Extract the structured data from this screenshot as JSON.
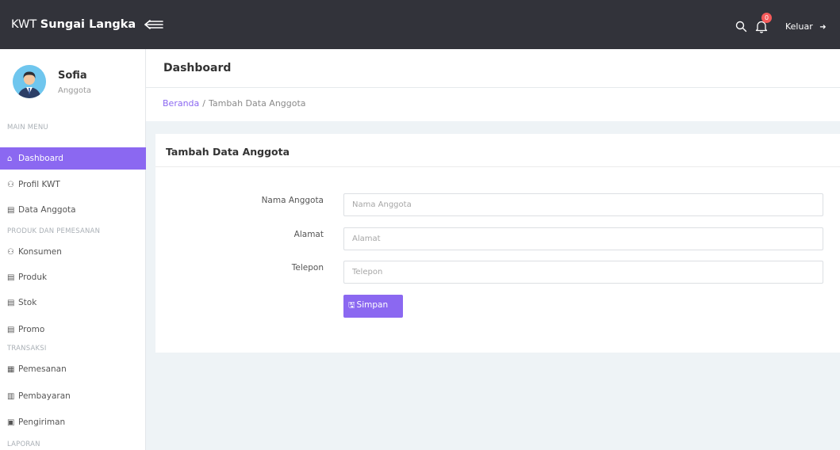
{
  "brand": {
    "prefix": "KWT",
    "name": "Sungai Langka"
  },
  "topbar": {
    "toggle_icon": "arrow-left-lines-icon",
    "search_icon": "search-icon",
    "bell_icon": "bell-icon",
    "notification_count": "0",
    "logout_label": "Keluar",
    "logout_icon": "➜"
  },
  "user": {
    "name": "Sofia",
    "role": "Anggota"
  },
  "sidebar": {
    "sections": [
      "MAIN MENU",
      "PRODUK DAN PEMESANAN",
      "TRANSAKSI",
      "LAPORAN"
    ],
    "items": [
      {
        "label": "Dashboard",
        "icon": "⌂"
      },
      {
        "label": "Profil KWT",
        "icon": "⚇"
      },
      {
        "label": "Data Anggota",
        "icon": "▤"
      },
      {
        "label": "Konsumen",
        "icon": "⚇"
      },
      {
        "label": "Produk",
        "icon": "▤"
      },
      {
        "label": "Stok",
        "icon": "▤"
      },
      {
        "label": "Promo",
        "icon": "▤"
      },
      {
        "label": "Pemesanan",
        "icon": "▦"
      },
      {
        "label": "Pembayaran",
        "icon": "▥"
      },
      {
        "label": "Pengiriman",
        "icon": "▣"
      }
    ]
  },
  "page": {
    "title": "Dashboard",
    "breadcrumb": {
      "home": "Beranda",
      "separator": "/",
      "current": "Tambah Data Anggota"
    }
  },
  "form": {
    "title": "Tambah Data Anggota",
    "fields": [
      {
        "label": "Nama Anggota",
        "placeholder": "Nama Anggota",
        "value": ""
      },
      {
        "label": "Alamat",
        "placeholder": "Alamat",
        "value": ""
      },
      {
        "label": "Telepon",
        "placeholder": "Telepon",
        "value": ""
      }
    ],
    "submit_label": "Simpan",
    "submit_icon": "🖫"
  },
  "colors": {
    "accent": "#8b68f1",
    "topbar": "#32333a",
    "badge": "#f55a5a",
    "background": "#eef3f6"
  }
}
